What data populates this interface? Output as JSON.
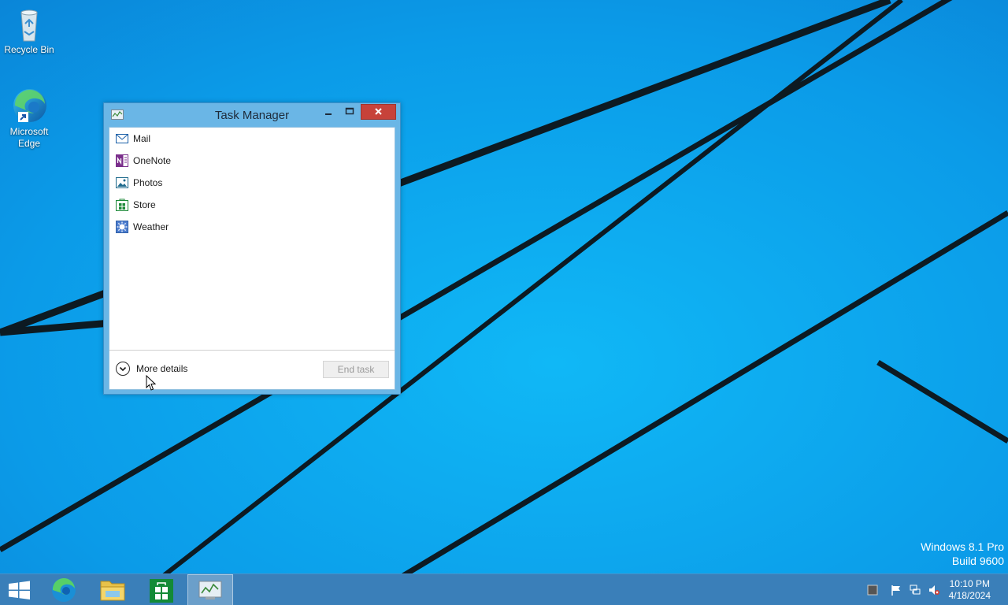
{
  "desktop": {
    "icons": [
      {
        "label": "Recycle Bin",
        "icon": "recycle-bin-icon"
      },
      {
        "label": "Microsoft Edge",
        "icon": "edge-icon"
      }
    ],
    "watermark": {
      "line1": "Windows 8.1 Pro",
      "line2": "Build 9600"
    },
    "wallpaper_color": "#0a8fe0"
  },
  "task_manager": {
    "title": "Task Manager",
    "processes": [
      {
        "label": "Mail",
        "icon": "mail-icon"
      },
      {
        "label": "OneNote",
        "icon": "onenote-icon"
      },
      {
        "label": "Photos",
        "icon": "photos-icon"
      },
      {
        "label": "Store",
        "icon": "store-icon"
      },
      {
        "label": "Weather",
        "icon": "weather-icon"
      }
    ],
    "more_details_label": "More details",
    "end_task_label": "End task",
    "end_task_enabled": false
  },
  "taskbar": {
    "items": [
      {
        "name": "start",
        "icon": "windows-logo-icon"
      },
      {
        "name": "edge",
        "icon": "edge-icon"
      },
      {
        "name": "file-explorer",
        "icon": "folder-icon"
      },
      {
        "name": "store",
        "icon": "store-icon"
      },
      {
        "name": "task-manager",
        "icon": "task-manager-icon",
        "active": true
      }
    ],
    "tray": [
      "show-desktop-icon",
      "action-center-flag-icon",
      "network-icon",
      "volume-muted-icon"
    ],
    "clock": {
      "time": "10:10 PM",
      "date": "4/18/2024"
    }
  }
}
